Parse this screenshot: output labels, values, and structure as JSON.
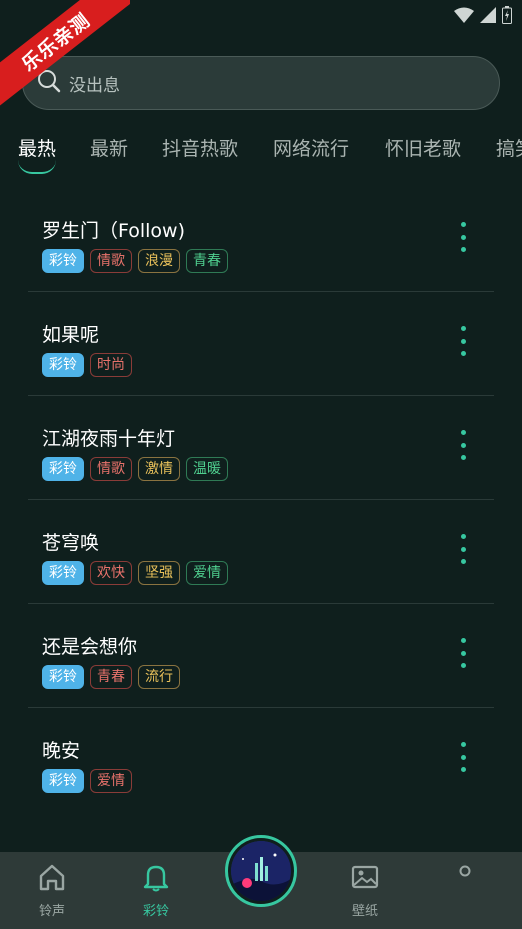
{
  "ribbon": {
    "text": "乐乐亲测"
  },
  "search": {
    "placeholder": "没出息"
  },
  "tabs": [
    {
      "label": "最热",
      "active": true
    },
    {
      "label": "最新"
    },
    {
      "label": "抖音热歌"
    },
    {
      "label": "网络流行"
    },
    {
      "label": "怀旧老歌"
    },
    {
      "label": "搞笑"
    }
  ],
  "songs": [
    {
      "title": "罗生门（Follow)",
      "tags": [
        {
          "text": "彩铃",
          "kind": "main"
        },
        {
          "text": "情歌",
          "kind": "red"
        },
        {
          "text": "浪漫",
          "kind": "yellow"
        },
        {
          "text": "青春",
          "kind": "green"
        }
      ]
    },
    {
      "title": "如果呢",
      "tags": [
        {
          "text": "彩铃",
          "kind": "main"
        },
        {
          "text": "时尚",
          "kind": "red"
        }
      ]
    },
    {
      "title": "江湖夜雨十年灯",
      "tags": [
        {
          "text": "彩铃",
          "kind": "main"
        },
        {
          "text": "情歌",
          "kind": "red"
        },
        {
          "text": "激情",
          "kind": "yellow"
        },
        {
          "text": "温暖",
          "kind": "green"
        }
      ]
    },
    {
      "title": "苍穹唤",
      "tags": [
        {
          "text": "彩铃",
          "kind": "main"
        },
        {
          "text": "欢快",
          "kind": "red"
        },
        {
          "text": "坚强",
          "kind": "yellow"
        },
        {
          "text": "爱情",
          "kind": "green"
        }
      ]
    },
    {
      "title": "还是会想你",
      "tags": [
        {
          "text": "彩铃",
          "kind": "main"
        },
        {
          "text": "青春",
          "kind": "red"
        },
        {
          "text": "流行",
          "kind": "yellow"
        }
      ]
    },
    {
      "title": "晚安",
      "tags": [
        {
          "text": "彩铃",
          "kind": "main"
        },
        {
          "text": "爱情",
          "kind": "red"
        }
      ]
    }
  ],
  "nav": {
    "ringtone_label": "铃声",
    "color_ring_label": "彩铃",
    "wallpaper_label": "壁纸"
  },
  "colors": {
    "accent": "#37c7a0",
    "background": "#0f1f1d",
    "tag_main": "#4fb3e8",
    "ribbon": "#d81e1e"
  }
}
